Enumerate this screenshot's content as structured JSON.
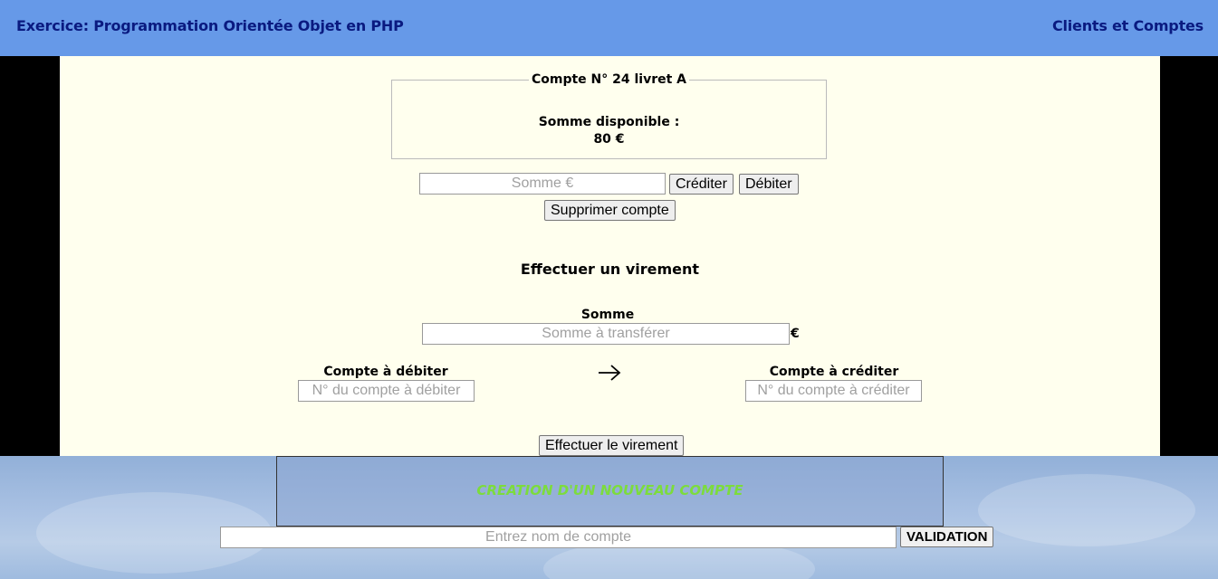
{
  "header": {
    "title": "Exercice: Programmation Orientée Objet en PHP",
    "nav_link": "Clients et Comptes"
  },
  "account": {
    "legend": "Compte N° 24 livret A",
    "balance_label": "Somme disponible :",
    "balance_value": "80 €",
    "amount_placeholder": "Somme €",
    "credit_label": "Créditer",
    "debit_label": "Débiter",
    "delete_label": "Supprimer compte"
  },
  "transfer": {
    "title": "Effectuer un virement",
    "amount_label": "Somme",
    "amount_placeholder": "Somme à transférer",
    "currency": "€",
    "from_label": "Compte à débiter",
    "from_placeholder": "N° du compte à débiter",
    "to_label": "Compte à créditer",
    "to_placeholder": "N° du compte à créditer",
    "submit_label": "Effectuer le virement"
  },
  "create_account": {
    "title": "CREATION D'UN NOUVEAU COMPTE",
    "name_placeholder": "Entrez nom de compte",
    "validate_label": "VALIDATION"
  },
  "icons": {
    "arrow": "arrow-right-icon"
  }
}
